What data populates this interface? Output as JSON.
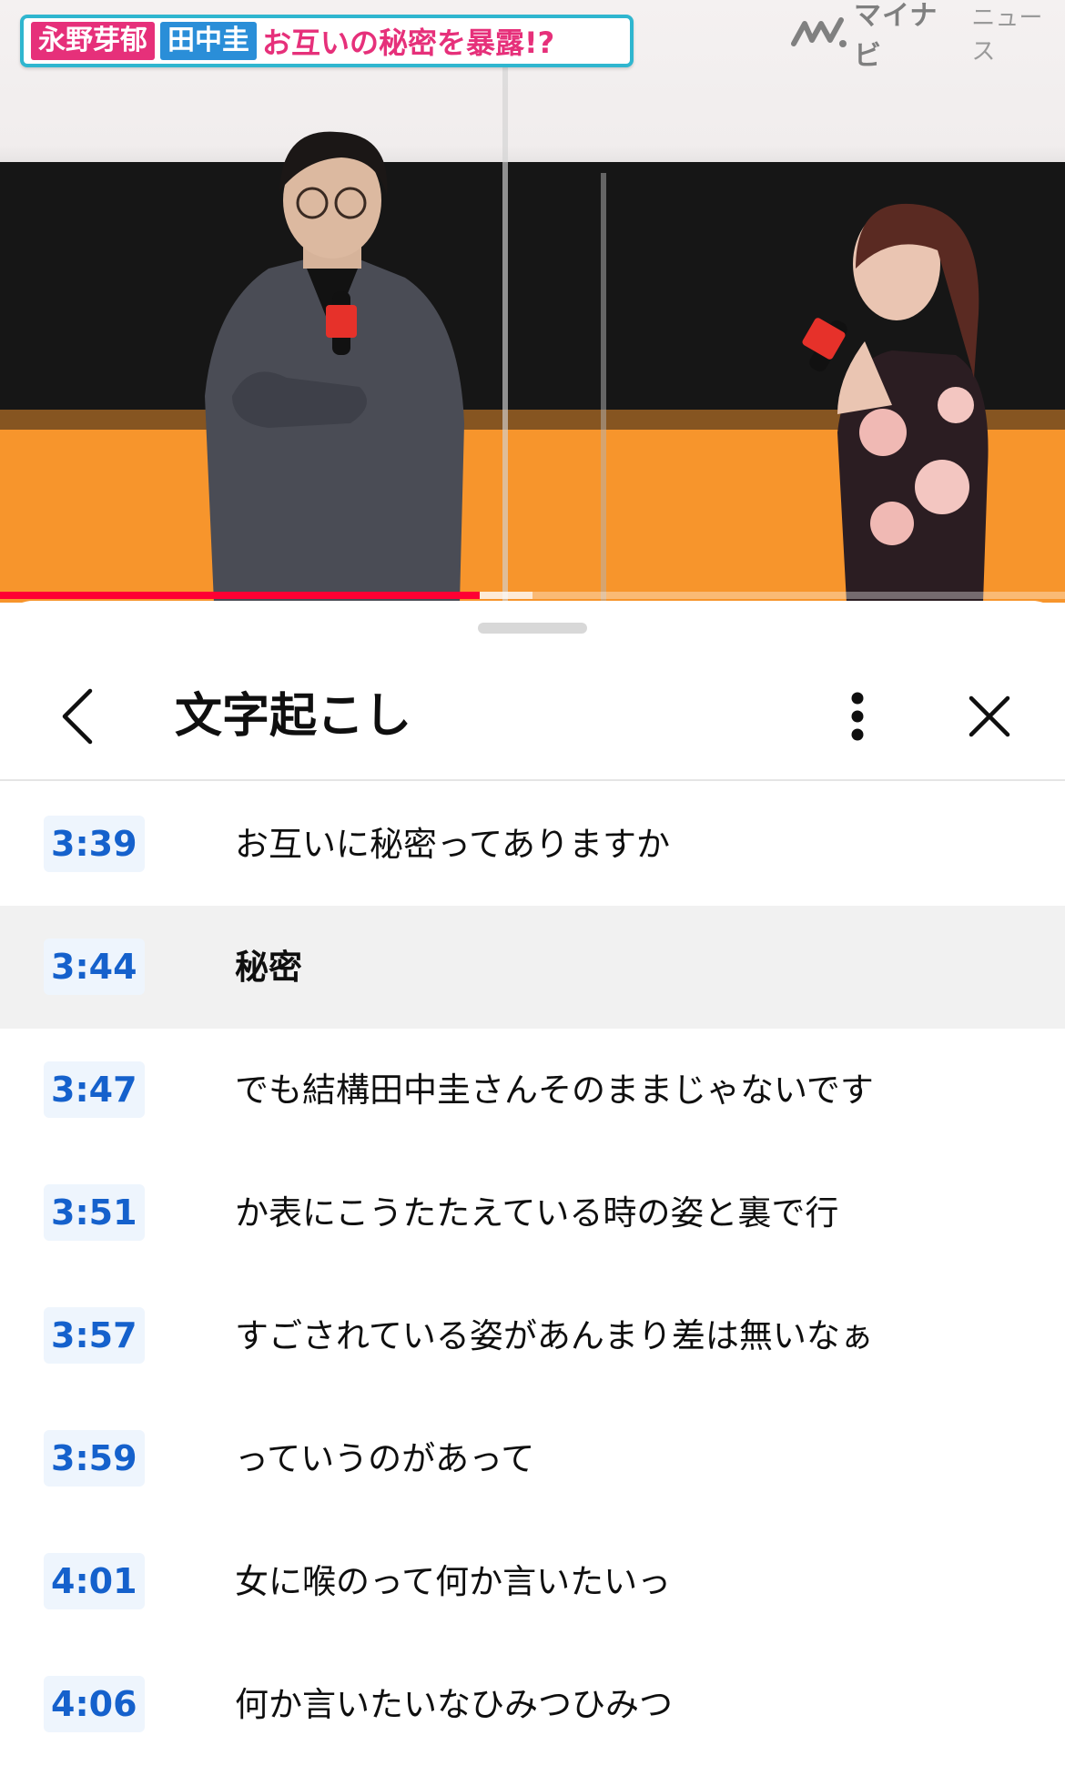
{
  "video": {
    "banner": {
      "name1": "永野芽郁",
      "name2": "田中圭",
      "headline": "お互いの秘密を暴露!?"
    },
    "logo": {
      "brand": "マイナビ",
      "sub": "ニュース"
    },
    "progress": {
      "played": 0.45,
      "buffered_to": 0.5
    }
  },
  "sheet": {
    "title": "文字起こし",
    "icons": {
      "back": "chevron-left-icon",
      "more": "more-vertical-icon",
      "close": "close-icon"
    }
  },
  "transcript": [
    {
      "time": "3:39",
      "text": "お互いに秘密ってありますか",
      "active": false
    },
    {
      "time": "3:44",
      "text": "秘密",
      "active": true
    },
    {
      "time": "3:47",
      "text": "でも結構田中圭さんそのままじゃないです",
      "active": false
    },
    {
      "time": "3:51",
      "text": "か表にこうたたえている時の姿と裏で行",
      "active": false
    },
    {
      "time": "3:57",
      "text": "すごされている姿があんまり差は無いなぁ",
      "active": false
    },
    {
      "time": "3:59",
      "text": "っていうのがあって",
      "active": false
    },
    {
      "time": "4:01",
      "text": "女に喉のって何か言いたいっ",
      "active": false
    },
    {
      "time": "4:06",
      "text": "何か言いたいなひみつひみつ",
      "active": false
    }
  ],
  "colors": {
    "timestamp": "#1561cc",
    "timestamp_bg": "#eef5fd",
    "active_row": "#f1f1f1",
    "progress": "#ff0033"
  }
}
